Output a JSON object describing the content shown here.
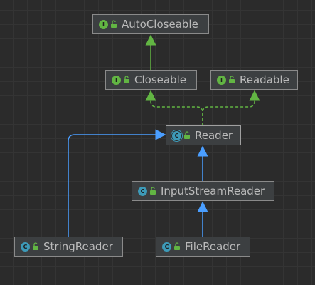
{
  "colors": {
    "background": "#2b2b2b",
    "node_fill": "#3c3f41",
    "node_border": "#8a8a8a",
    "text": "#bbbbbb",
    "interface_badge": "#62b543",
    "class_badge": "#3d9ab8",
    "extends_edge": "#4a9eff",
    "implements_edge": "#62b543"
  },
  "nodes": {
    "autocloseable": {
      "label": "AutoCloseable",
      "kind": "interface",
      "badge": "I",
      "icon": "interface-icon"
    },
    "closeable": {
      "label": "Closeable",
      "kind": "interface",
      "badge": "I",
      "icon": "interface-icon"
    },
    "readable": {
      "label": "Readable",
      "kind": "interface",
      "badge": "I",
      "icon": "interface-icon"
    },
    "reader": {
      "label": "Reader",
      "kind": "abstract-class",
      "badge": "C",
      "icon": "abstract-class-icon"
    },
    "inputstreamreader": {
      "label": "InputStreamReader",
      "kind": "class",
      "badge": "C",
      "icon": "class-icon"
    },
    "stringreader": {
      "label": "StringReader",
      "kind": "class",
      "badge": "C",
      "icon": "class-icon"
    },
    "filereader": {
      "label": "FileReader",
      "kind": "class",
      "badge": "C",
      "icon": "class-icon"
    }
  },
  "edges": [
    {
      "from": "closeable",
      "to": "autocloseable",
      "relation": "extends-interface"
    },
    {
      "from": "reader",
      "to": "closeable",
      "relation": "implements"
    },
    {
      "from": "reader",
      "to": "readable",
      "relation": "implements"
    },
    {
      "from": "inputstreamreader",
      "to": "reader",
      "relation": "extends"
    },
    {
      "from": "stringreader",
      "to": "reader",
      "relation": "extends"
    },
    {
      "from": "filereader",
      "to": "inputstreamreader",
      "relation": "extends"
    }
  ]
}
